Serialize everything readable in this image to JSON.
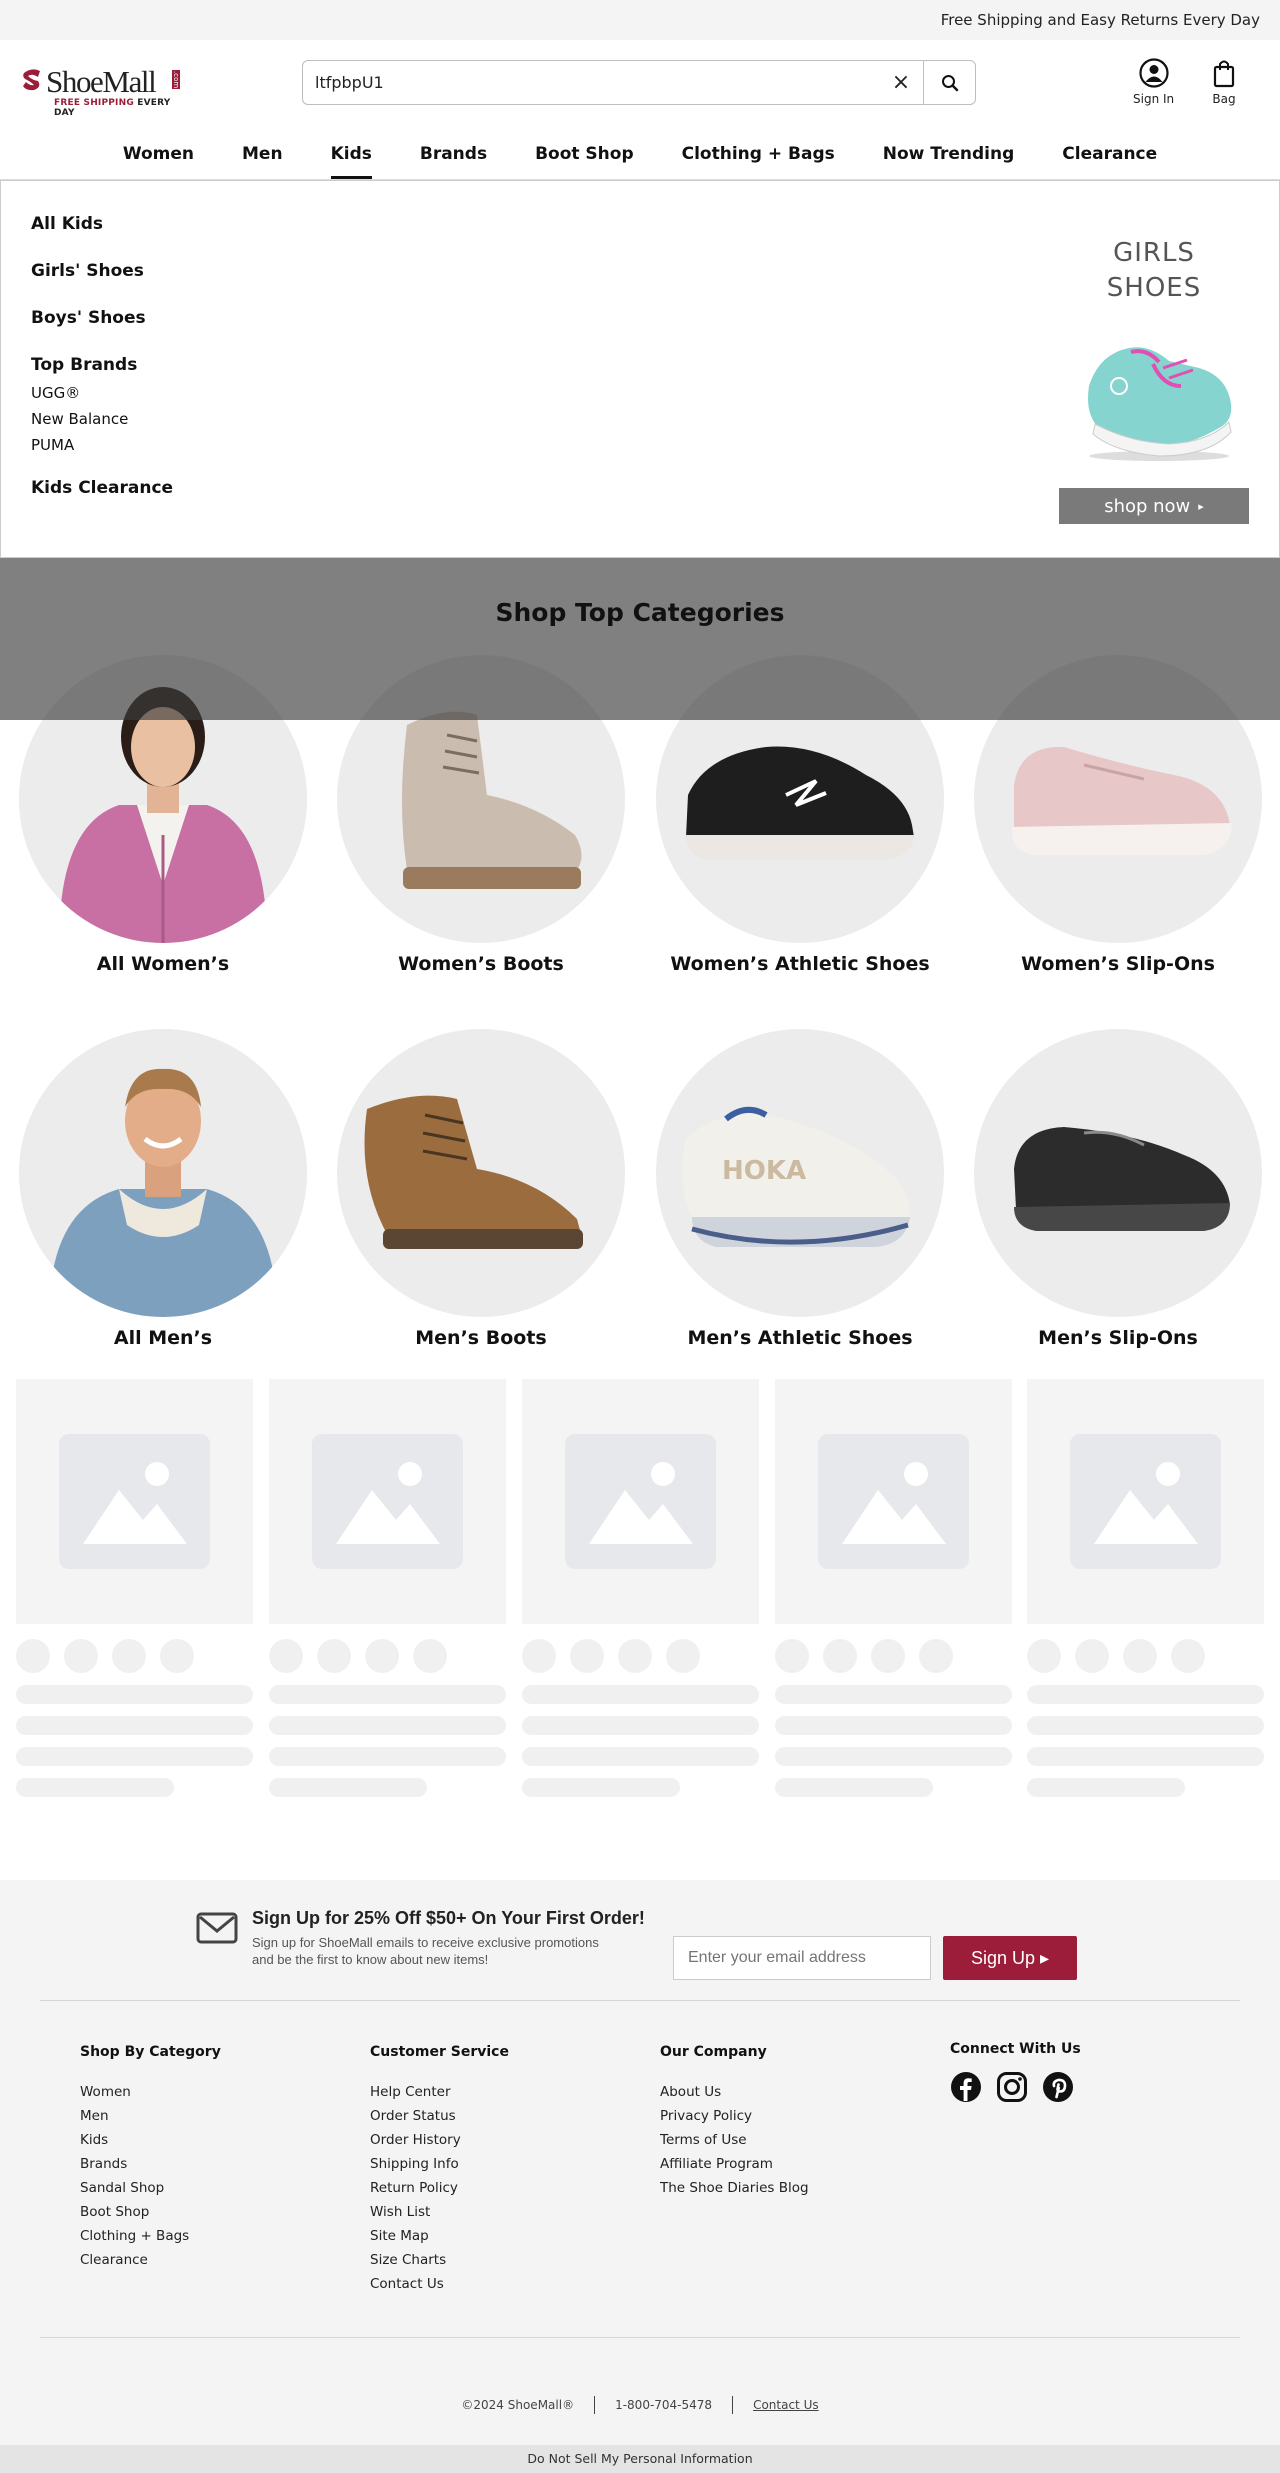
{
  "promo_bar": {
    "text": "Free Shipping and Easy Returns Every Day"
  },
  "logo": {
    "text": "ShoeMall",
    "com": ".com",
    "tagline_red": "FREE SHIPPING",
    "tagline_dark": " EVERY DAY"
  },
  "search": {
    "value": "ltfpbpU1",
    "clear_icon": "×"
  },
  "header": {
    "sign_in_label": "Sign In",
    "bag_label": "Bag"
  },
  "nav": {
    "items": [
      {
        "label": "Women"
      },
      {
        "label": "Men"
      },
      {
        "label": "Kids"
      },
      {
        "label": "Brands"
      },
      {
        "label": "Boot Shop"
      },
      {
        "label": "Clothing + Bags"
      },
      {
        "label": "Now Trending"
      },
      {
        "label": "Clearance"
      }
    ]
  },
  "dropdown": {
    "all_kids": "All Kids",
    "girls_shoes": "Girls' Shoes",
    "boys_shoes": "Boys' Shoes",
    "top_brands": "Top Brands",
    "brands": [
      "UGG®",
      "New Balance",
      "PUMA"
    ],
    "kids_clearance": "Kids Clearance",
    "promo_title_line1": "GIRLS",
    "promo_title_line2": "SHOES",
    "shop_now": "shop now",
    "shop_now_arrow": "▸"
  },
  "categories": {
    "title": "Shop Top Categories",
    "items": [
      {
        "label": "All Women’s"
      },
      {
        "label": "Women’s Boots"
      },
      {
        "label": "Women’s Athletic Shoes"
      },
      {
        "label": "Women’s Slip-Ons"
      },
      {
        "label": "All Men’s"
      },
      {
        "label": "Men’s Boots"
      },
      {
        "label": "Men’s Athletic Shoes"
      },
      {
        "label": "Men’s Slip-Ons"
      }
    ]
  },
  "signup": {
    "heading": "Sign Up for 25% Off $50+ On Your First Order!",
    "body": "Sign up for ShoeMall emails to receive exclusive promotions and be the first to know about new items!",
    "placeholder": "Enter your email address",
    "button": "Sign Up ▸"
  },
  "footer": {
    "shop_by_category": {
      "heading": "Shop By Category",
      "links": [
        "Women",
        "Men",
        "Kids",
        "Brands",
        "Sandal Shop",
        "Boot Shop",
        "Clothing + Bags",
        "Clearance"
      ]
    },
    "customer_service": {
      "heading": "Customer Service",
      "links": [
        "Help Center",
        "Order Status",
        "Order History",
        "Shipping Info",
        "Return Policy",
        "Wish List",
        "Site Map",
        "Size Charts",
        "Contact Us"
      ]
    },
    "our_company": {
      "heading": "Our Company",
      "links": [
        "About Us",
        "Privacy Policy",
        "Terms of Use",
        "Affiliate Program",
        "The Shoe Diaries Blog"
      ]
    },
    "connect": {
      "heading": "Connect With Us",
      "icons": [
        "facebook-icon",
        "instagram-icon",
        "pinterest-icon"
      ]
    },
    "copyright": "©2024 ShoeMall®",
    "phone": "1-800-704-5478",
    "contact": "Contact Us",
    "do_not_sell": "Do Not Sell My Personal Information"
  },
  "colors": {
    "brand": "#9b1d3a",
    "promo_bg": "#f4f4f4",
    "footer_bg": "#f4f4f4",
    "shop_now_bg": "#7a7a7a"
  }
}
